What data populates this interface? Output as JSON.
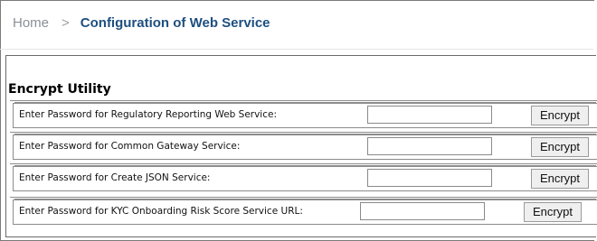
{
  "breadcrumb": {
    "home": "Home",
    "separator": ">",
    "current": "Configuration of Web Service"
  },
  "section": {
    "title": "Encrypt Utility"
  },
  "rows": [
    {
      "label": "Enter Password for Regulatory Reporting Web Service:",
      "value": "",
      "button": "Encrypt"
    },
    {
      "label": "Enter Password for Common Gateway Service:",
      "value": "",
      "button": "Encrypt"
    },
    {
      "label": "Enter Password for Create JSON Service:",
      "value": "",
      "button": "Encrypt"
    },
    {
      "label": "Enter Password for KYC Onboarding Risk Score Service URL:",
      "value": "",
      "button": "Encrypt"
    }
  ]
}
